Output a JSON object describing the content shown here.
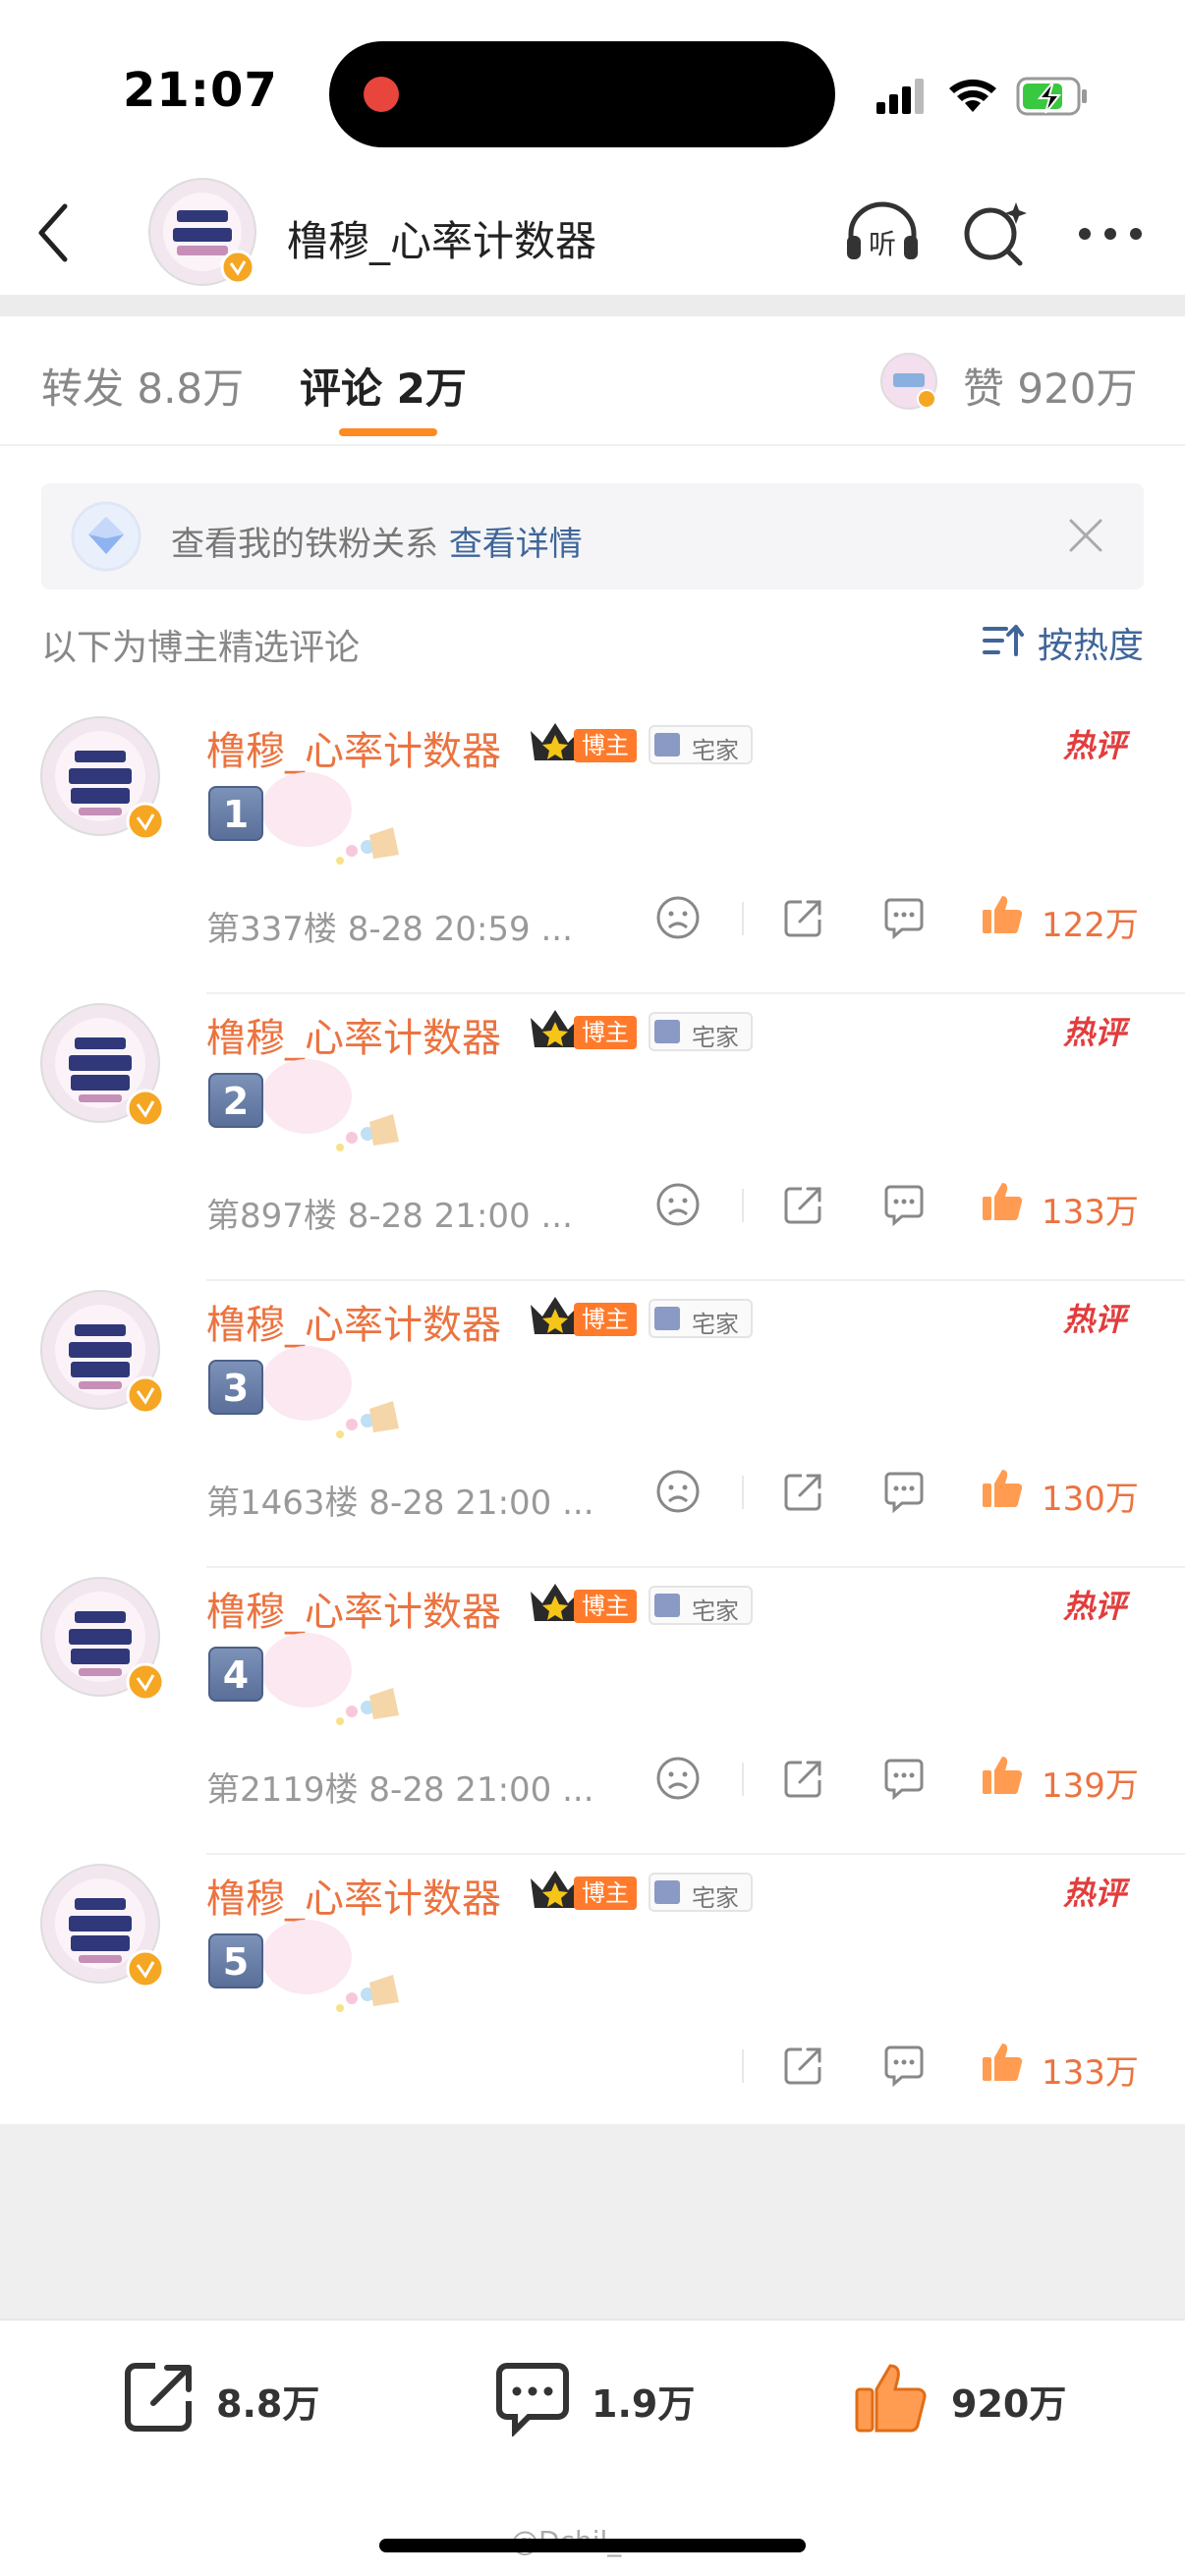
{
  "status": {
    "time": "21:07"
  },
  "nav": {
    "title": "橹穆_心率计数器"
  },
  "tabs": [
    {
      "label": "转发 8.8万",
      "active": false
    },
    {
      "label": "评论 2万",
      "active": true
    }
  ],
  "likes_total": "赞 920万",
  "fan_banner": {
    "text": "查看我的铁粉关系",
    "link": "查看详情"
  },
  "section": {
    "title": "以下为博主精选评论",
    "sort_label": "按热度"
  },
  "comments": [
    {
      "name": "橹穆_心率计数器",
      "owner_badge": "博主",
      "tag": "宅家",
      "hot": "热评",
      "num": "1",
      "meta": "第337楼 8-28 20:59 ...",
      "likes": "122万"
    },
    {
      "name": "橹穆_心率计数器",
      "owner_badge": "博主",
      "tag": "宅家",
      "hot": "热评",
      "num": "2",
      "meta": "第897楼 8-28 21:00 ...",
      "likes": "133万"
    },
    {
      "name": "橹穆_心率计数器",
      "owner_badge": "博主",
      "tag": "宅家",
      "hot": "热评",
      "num": "3",
      "meta": "第1463楼 8-28 21:00 ...",
      "likes": "130万"
    },
    {
      "name": "橹穆_心率计数器",
      "owner_badge": "博主",
      "tag": "宅家",
      "hot": "热评",
      "num": "4",
      "meta": "第2119楼 8-28 21:00 ...",
      "likes": "139万"
    },
    {
      "name": "橹穆_心率计数器",
      "owner_badge": "博主",
      "tag": "宅家",
      "hot": "热评",
      "num": "5",
      "meta": "",
      "likes": "133万"
    }
  ],
  "bottom_bar": {
    "repost": "8.8万",
    "comment": "1.9万",
    "like": "920万"
  },
  "watermark": "@Dchil_",
  "colors": {
    "accent": "#eb7340",
    "link": "#406599",
    "hot": "#e23d3d",
    "tab_underline": "#ff8a1f"
  },
  "icons": [
    "back-icon",
    "listen-icon",
    "search-icon",
    "more-icon",
    "fan-diamond-icon",
    "close-icon",
    "sort-icon",
    "dislike-icon",
    "share-icon",
    "comment-icon",
    "like-icon"
  ]
}
